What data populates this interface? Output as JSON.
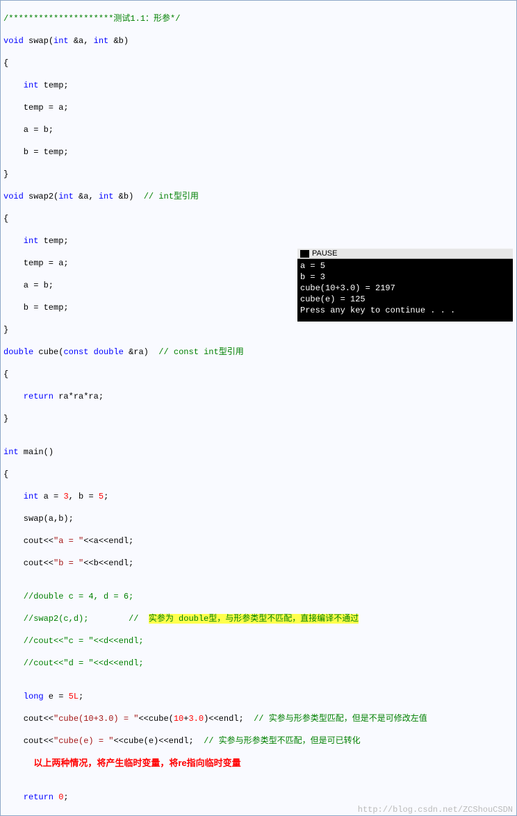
{
  "code": {
    "l01": "/*********************测试1.1：形参*/",
    "l02a": "void",
    "l02b": " swap(",
    "l02c": "int",
    "l02d": " &a, ",
    "l02e": "int",
    "l02f": " &b)",
    "l03": "{",
    "l04": "    int",
    "l04b": " temp;",
    "l05": "    temp = a;",
    "l06": "    a = b;",
    "l07": "    b = temp;",
    "l08": "}",
    "l09a": "void",
    "l09b": " swap2(",
    "l09c": "int",
    "l09d": " &a, ",
    "l09e": "int",
    "l09f": " &b)  ",
    "l09g": "// int型引用",
    "l10": "{",
    "l11": "    int",
    "l11b": " temp;",
    "l12": "    temp = a;",
    "l13": "    a = b;",
    "l14": "    b = temp;",
    "l15": "}",
    "l16a": "double",
    "l16b": " cube(",
    "l16c": "const",
    "l16d": " ",
    "l16e": "double",
    "l16f": " &ra)  ",
    "l16g": "// const int型引用",
    "l17": "{",
    "l18": "    return",
    "l18b": " ra*ra*ra;",
    "l19": "}",
    "l20": "",
    "l21a": "int",
    "l21b": " main()",
    "l22": "{",
    "l23a": "    int",
    "l23b": " a = ",
    "l23c": "3",
    "l23d": ", b = ",
    "l23e": "5",
    "l23f": ";",
    "l24": "    swap(a,b);",
    "l25a": "    cout<<",
    "l25b": "\"a = \"",
    "l25c": "<<a<<endl;",
    "l26a": "    cout<<",
    "l26b": "\"b = \"",
    "l26c": "<<b<<endl;",
    "l27": "",
    "l28": "    //double c = 4, d = 6;",
    "l29a": "    //swap2(c,d);        //  ",
    "l29b": "实参为 double型，与形参类型不匹配，直接编译不通过",
    "l30": "    //cout<<\"c = \"<<d<<endl;",
    "l31": "    //cout<<\"d = \"<<d<<endl;",
    "l32": "",
    "l33a": "    long",
    "l33b": " e = ",
    "l33c": "5L",
    "l33d": ";",
    "l34a": "    cout<<",
    "l34b": "\"cube(10+3.0) = \"",
    "l34c": "<<cube(",
    "l34d": "10",
    "l34e": "+",
    "l34f": "3.0",
    "l34g": ")<<endl;  ",
    "l34h": "// 实参与形参类型匹配，但是不是可修改左值",
    "l35a": "    cout<<",
    "l35b": "\"cube(e) = \"",
    "l35c": "<<cube(e)<<endl;  ",
    "l35d": "// 实参与形参类型不匹配，但是可已转化",
    "l36": "            以上两种情况，将产生临时变量，将re指向临时变量",
    "l37": "",
    "l38a": "    return",
    "l38b": " ",
    "l38c": "0",
    "l38d": ";"
  },
  "console": {
    "title": "PAUSE",
    "l1": "a = 5",
    "l2": "b = 3",
    "l3": "cube(10+3.0) = 2197",
    "l4": "cube(e) = 125",
    "l5": "Press any key to continue . . ."
  },
  "watermark": "http://blog.csdn.net/ZCShouCSDN"
}
